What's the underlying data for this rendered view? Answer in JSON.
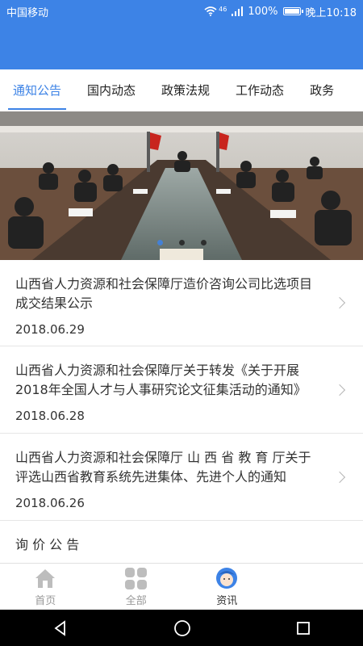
{
  "status_bar": {
    "carrier": "中国移动",
    "signal": "46",
    "battery": "100%",
    "battery_level": 1.0,
    "time": "晚上10:18"
  },
  "tabs": [
    {
      "label": "通知公告",
      "active": true
    },
    {
      "label": "国内动态",
      "active": false
    },
    {
      "label": "政策法规",
      "active": false
    },
    {
      "label": "工作动态",
      "active": false
    },
    {
      "label": "政务",
      "active": false
    }
  ],
  "banner": {
    "slide_count": 3,
    "active_slide": 1
  },
  "news": [
    {
      "title": "山西省人力资源和社会保障厅造价咨询公司比选项目成交结果公示",
      "date": "2018.06.29"
    },
    {
      "title": "山西省人力资源和社会保障厅关于转发《关于开展2018年全国人才与人事研究论文征集活动的通知》",
      "date": "2018.06.28"
    },
    {
      "title": "山西省人力资源和社会保障厅 山 西 省 教 育 厅关于评选山西省教育系统先进集体、先进个人的通知",
      "date": "2018.06.26"
    },
    {
      "title": "询 价 公 告",
      "date": ""
    }
  ],
  "bottom_nav": [
    {
      "label": "首页",
      "icon": "home-icon",
      "active": false
    },
    {
      "label": "全部",
      "icon": "grid-icon",
      "active": false
    },
    {
      "label": "资讯",
      "icon": "news-avatar-icon",
      "active": true
    },
    {
      "label": "",
      "icon": "",
      "active": false
    }
  ],
  "colors": {
    "primary": "#3d83e6",
    "text": "#333333",
    "divider": "#e6e6e6",
    "nav_inactive": "#999999"
  }
}
